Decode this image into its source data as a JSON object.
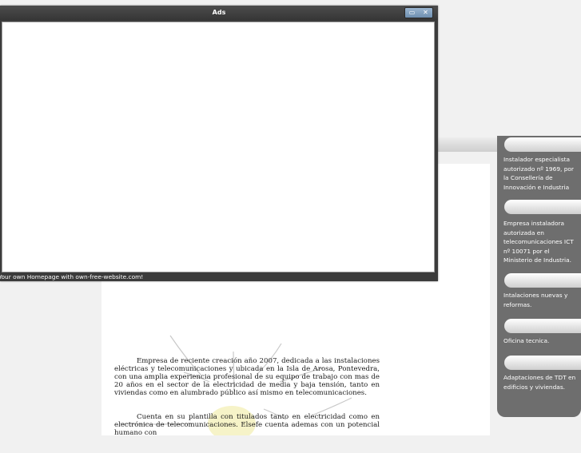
{
  "ads_window": {
    "title": "Ads",
    "minimize_glyph": "▭",
    "close_glyph": "✕",
    "footer_text": "Your own Homepage with own-free-website.com!"
  },
  "sidebar": {
    "items": [
      {
        "text": "Instalador especialista autorizado nº 1969, por la Consellería de Innovación e Industria"
      },
      {
        "text": "Empresa instaladora autorizada en telecomunicaciones ICT nº 10071 por el Ministerio de Industria."
      },
      {
        "text": "Intalaciones nuevas y reformas."
      },
      {
        "text": "Oficina tecnica."
      },
      {
        "text": "Adaptaciones de TDT en edificios y viviendas."
      }
    ]
  },
  "article": {
    "paragraphs": [
      "Empresa de reciente creación año 2007, dedicada a las instalaciones eléctricas y telecomunicaciones y ubicada en la Isla de Arosa, Pontevedra, con una amplia experiencia profesional de su equipo de trabajo con mas de 20 años en el sector de la electricidad de media y baja tensión, tanto en viviendas como en alumbrado público así mismo en telecomunicaciones.",
      "Cuenta en su plantilla con titulados tanto en electricidad como en electrónica de telecomunicaciones. Elsefe cuenta ademas con un potencial humano con"
    ]
  },
  "colors": {
    "sidebar_bg": "#6e6e6e",
    "window_frame": "#3b3b3b",
    "page_bg": "#f1f1f1"
  }
}
